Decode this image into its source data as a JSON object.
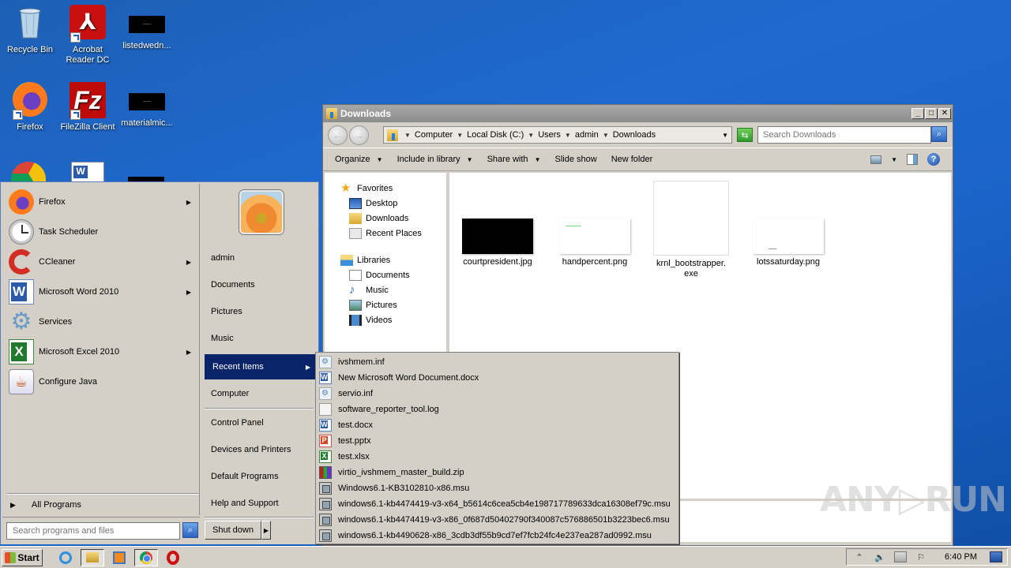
{
  "desktop": {
    "icons": [
      {
        "label": "Recycle Bin",
        "icon": "recycle-bin-icon"
      },
      {
        "label": "Acrobat Reader DC",
        "icon": "acrobat-icon"
      },
      {
        "label": "listedwedn...",
        "icon": "black-thumbnail"
      },
      {
        "label": "Firefox",
        "icon": "firefox-icon"
      },
      {
        "label": "FileZilla Client",
        "icon": "filezilla-icon"
      },
      {
        "label": "materialmic...",
        "icon": "black-thumbnail"
      }
    ]
  },
  "explorer": {
    "title": "Downloads",
    "breadcrumb": [
      "Computer",
      "Local Disk (C:)",
      "Users",
      "admin",
      "Downloads"
    ],
    "search_placeholder": "Search Downloads",
    "commands": [
      {
        "label": "Organize",
        "dropdown": true
      },
      {
        "label": "Include in library",
        "dropdown": true
      },
      {
        "label": "Share with",
        "dropdown": true
      },
      {
        "label": "Slide show",
        "dropdown": false
      },
      {
        "label": "New folder",
        "dropdown": false
      }
    ],
    "nav": {
      "favorites": {
        "label": "Favorites",
        "items": [
          "Desktop",
          "Downloads",
          "Recent Places"
        ]
      },
      "libraries": {
        "label": "Libraries",
        "items": [
          "Documents",
          "Music",
          "Pictures",
          "Videos"
        ]
      }
    },
    "files": [
      {
        "name": "courtpresident.jpg",
        "thumb": "black"
      },
      {
        "name": "handpercent.png",
        "thumb": "white"
      },
      {
        "name": "krnl_bootstrapper.\nexe",
        "thumb": "blank-large"
      },
      {
        "name": "lotssaturday.png",
        "thumb": "white"
      }
    ]
  },
  "start_menu": {
    "programs": [
      {
        "label": "Firefox",
        "submenu": true
      },
      {
        "label": "Task Scheduler",
        "submenu": false
      },
      {
        "label": "CCleaner",
        "submenu": true
      },
      {
        "label": "Microsoft Word 2010",
        "submenu": true
      },
      {
        "label": "Services",
        "submenu": false
      },
      {
        "label": "Microsoft Excel 2010",
        "submenu": true
      },
      {
        "label": "Configure Java",
        "submenu": false
      }
    ],
    "all_programs": "All Programs",
    "search_placeholder": "Search programs and files",
    "right_links": {
      "user": "admin",
      "documents": "Documents",
      "pictures": "Pictures",
      "music": "Music",
      "recent_items": "Recent Items",
      "computer": "Computer",
      "control_panel": "Control Panel",
      "devices_printers": "Devices and Printers",
      "default_programs": "Default Programs",
      "help_support": "Help and Support"
    },
    "shutdown": "Shut down"
  },
  "recent_items": [
    {
      "name": "ivshmem.inf",
      "type": "inf"
    },
    {
      "name": "New Microsoft Word Document.docx",
      "type": "word"
    },
    {
      "name": "servio.inf",
      "type": "inf"
    },
    {
      "name": "software_reporter_tool.log",
      "type": "doc"
    },
    {
      "name": "test.docx",
      "type": "word"
    },
    {
      "name": "test.pptx",
      "type": "ppt"
    },
    {
      "name": "test.xlsx",
      "type": "xls"
    },
    {
      "name": "virtio_ivshmem_master_build.zip",
      "type": "zip"
    },
    {
      "name": "Windows6.1-KB3102810-x86.msu",
      "type": "msu"
    },
    {
      "name": "windows6.1-kb4474419-v3-x64_b5614c6cea5cb4e198717789633dca16308ef79c.msu",
      "type": "msu"
    },
    {
      "name": "windows6.1-kb4474419-v3-x86_0f687d50402790f340087c576886501b3223bec6.msu",
      "type": "msu"
    },
    {
      "name": "windows6.1-kb4490628-x86_3cdb3df55b9cd7ef7fcb24fc4e237ea287ad0992.msu",
      "type": "msu"
    }
  ],
  "taskbar": {
    "start_label": "Start",
    "clock": "6:40 PM"
  },
  "watermark": "ANY▷RUN"
}
